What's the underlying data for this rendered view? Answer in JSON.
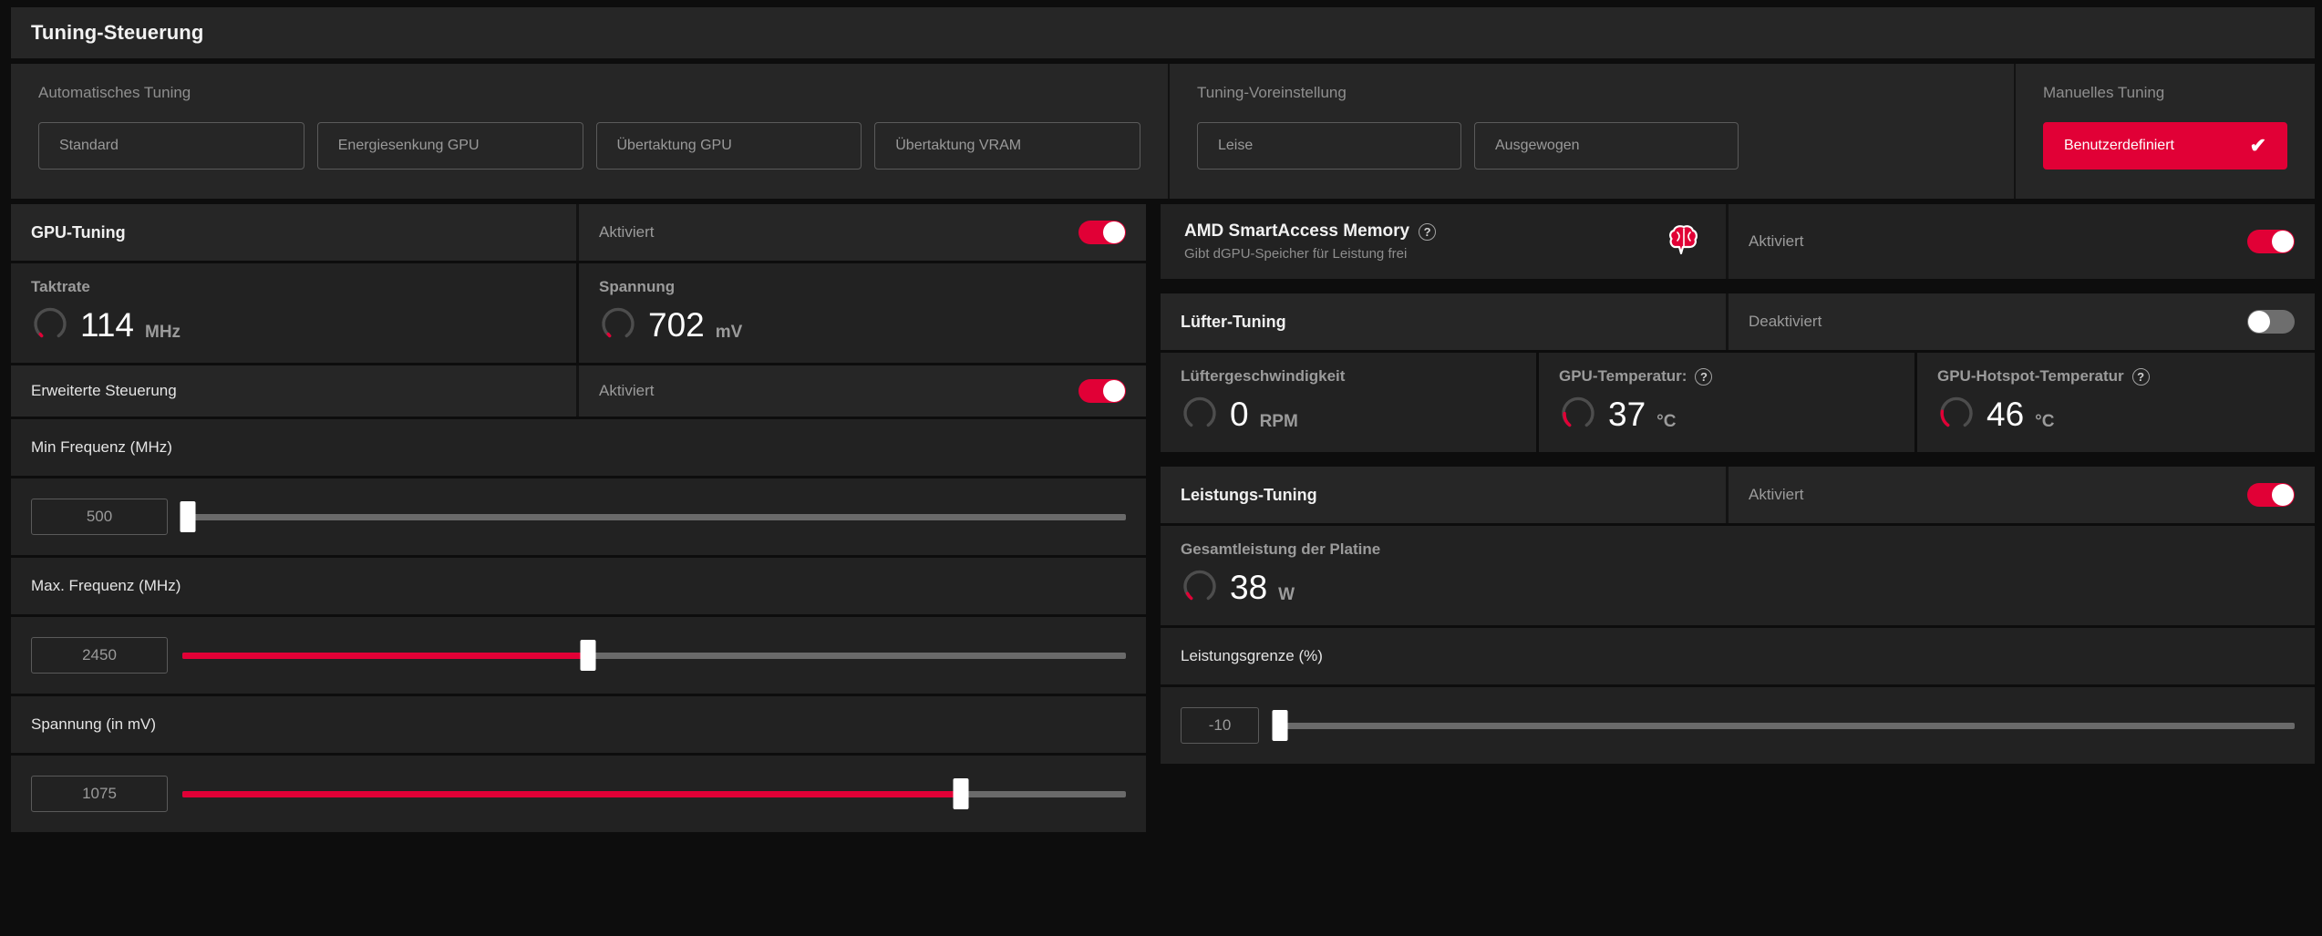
{
  "window": {
    "title": "Tuning-Steuerung"
  },
  "colors": {
    "accent": "#e10036",
    "panel": "#262626",
    "tile": "#222222",
    "page_background": "#0d0d0d",
    "text_primary": "#f2f2f2",
    "text_muted": "#9a9a9a",
    "track": "#6a6a6a"
  },
  "presets": {
    "auto": {
      "caption": "Automatisches Tuning",
      "buttons": [
        {
          "label": "Standard",
          "active": false
        },
        {
          "label": "Energiesenkung GPU",
          "active": false
        },
        {
          "label": "Übertaktung GPU",
          "active": false
        },
        {
          "label": "Übertaktung VRAM",
          "active": false
        }
      ]
    },
    "tuning_preset": {
      "caption": "Tuning-Voreinstellung",
      "buttons": [
        {
          "label": "Leise",
          "active": false
        },
        {
          "label": "Ausgewogen",
          "active": false
        }
      ]
    },
    "manual": {
      "caption": "Manuelles Tuning",
      "button": {
        "label": "Benutzerdefiniert",
        "active": true,
        "check_glyph": "✔"
      }
    }
  },
  "gpu_tuning": {
    "title": "GPU-Tuning",
    "state_label": "Aktiviert",
    "enabled": true,
    "metrics": [
      {
        "label": "Taktrate",
        "value": "114",
        "unit": "MHz",
        "gauge_pct": 4
      },
      {
        "label": "Spannung",
        "value": "702",
        "unit": "mV",
        "gauge_pct": 4
      }
    ],
    "advanced": {
      "title": "Erweiterte Steuerung",
      "state_label": "Aktiviert",
      "enabled": true
    },
    "sliders": [
      {
        "label": "Min Frequenz (MHz)",
        "value": "500",
        "fill_pct": 0,
        "thumb_pct": 0
      },
      {
        "label": "Max. Frequenz (MHz)",
        "value": "2450",
        "fill_pct": 43,
        "thumb_pct": 43
      },
      {
        "label": "Spannung (in mV)",
        "value": "1075",
        "fill_pct": 82.5,
        "thumb_pct": 82.5
      }
    ]
  },
  "smart_access_memory": {
    "title": "AMD SmartAccess Memory",
    "help_glyph": "?",
    "subtitle": "Gibt dGPU-Speicher für Leistung frei",
    "icon": "brain-icon",
    "state_label": "Aktiviert",
    "enabled": true
  },
  "fan_tuning": {
    "title": "Lüfter-Tuning",
    "state_label": "Deaktiviert",
    "enabled": false,
    "metrics": [
      {
        "label": "Lüftergeschwindigkeit",
        "value": "0",
        "unit": "RPM",
        "gauge_pct": 0,
        "help": false
      },
      {
        "label": "GPU-Temperatur:",
        "value": "37",
        "unit": "°C",
        "gauge_pct": 22,
        "help": true,
        "help_glyph": "?"
      },
      {
        "label": "GPU-Hotspot-Temperatur",
        "value": "46",
        "unit": "°C",
        "gauge_pct": 26,
        "help": true,
        "help_glyph": "?"
      }
    ]
  },
  "power_tuning": {
    "title": "Leistungs-Tuning",
    "state_label": "Aktiviert",
    "enabled": true,
    "metric": {
      "label": "Gesamtleistung der Platine",
      "value": "38",
      "unit": "W",
      "gauge_pct": 8
    },
    "slider": {
      "label": "Leistungsgrenze (%)",
      "value": "-10",
      "fill_pct": 0,
      "thumb_pct": 0
    }
  }
}
